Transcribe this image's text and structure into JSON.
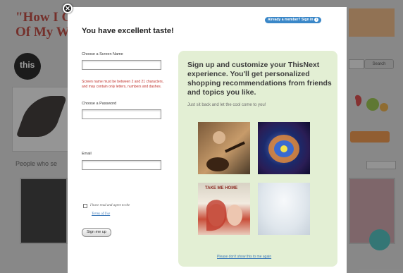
{
  "background": {
    "headline_line1": "\"How I G",
    "headline_line2": "Of My Wr",
    "logo_text": "this",
    "people_label": "People who se",
    "search_button": "Search"
  },
  "modal": {
    "title": "You have excellent taste!",
    "member_link": "Already a member? Sign in",
    "close_symbol": "✕",
    "screen_name_label": "Choose a Screen Name",
    "screen_name_value": "",
    "screen_name_error": "Screen name must be between 2 and 21 characters, and may contain only letters, numbers and dashes.",
    "password_label": "Choose a Password",
    "password_value": "",
    "email_label": "Email",
    "email_value": "",
    "terms_text": "I have read and agree to the",
    "terms_link": "Terms of Use",
    "signup_button": "Sign me up"
  },
  "promo": {
    "headline": "Sign up and customize your ThisNext experience. You'll get personalized shopping recommendations from friends and topics you like.",
    "subtext": "Just sit back and let the cool come to you!",
    "albums": [
      {
        "caption": ""
      },
      {
        "caption": ""
      },
      {
        "caption": "TAKE ME HOME"
      },
      {
        "caption": ""
      }
    ],
    "footer_link": "Please don't show this to me again"
  }
}
